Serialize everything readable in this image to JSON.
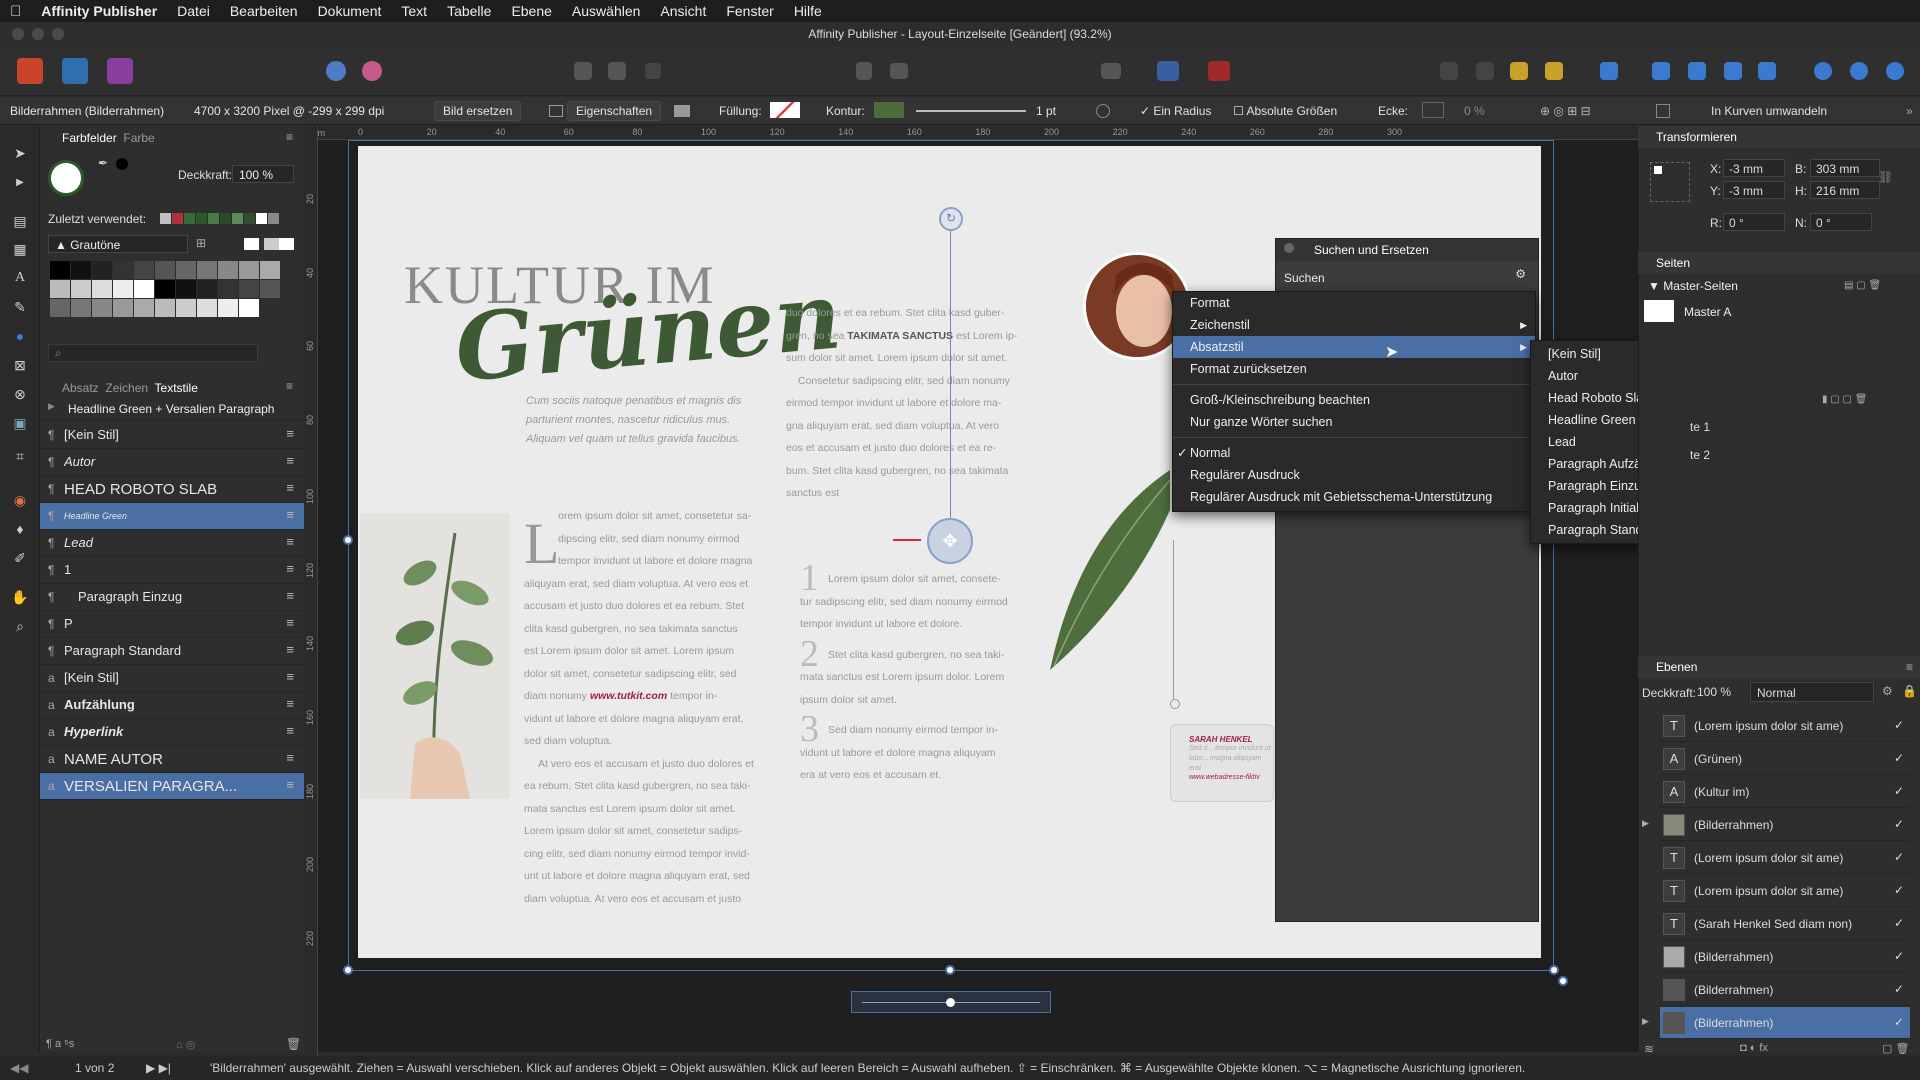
{
  "menubar": {
    "app": "Affinity Publisher",
    "items": [
      "Datei",
      "Bearbeiten",
      "Dokument",
      "Text",
      "Tabelle",
      "Ebene",
      "Auswählen",
      "Ansicht",
      "Fenster",
      "Hilfe"
    ]
  },
  "window": {
    "title": "Affinity Publisher - Layout-Einzelseite [Geändert] (93.2%)"
  },
  "context": {
    "selection": "Bilderrahmen (Bilderrahmen)",
    "size_info": "4700 x 3200 Pixel @ -299 x 299 dpi",
    "replace_btn": "Bild ersetzen",
    "properties_btn": "Eigenschaften",
    "fill_label": "Füllung:",
    "stroke_label": "Kontur:",
    "stroke_width": "1 pt",
    "radius_label": "Ein Radius",
    "absolute_label": "Absolute Größen",
    "corner_label": "Ecke:",
    "corner_value": "0 %",
    "convert_btn": "In Kurven umwandeln",
    "stroke_color": "#4f6b3b"
  },
  "swatches": {
    "tab_swatches": "Farbfelder",
    "tab_color": "Farbe",
    "opacity_label": "Deckkraft:",
    "opacity_value": "100 %",
    "recent_label": "Zuletzt verwendet:",
    "palette": "Grautöne",
    "recent": [
      "#c0c0c0",
      "#b03040",
      "#3a6a3a",
      "#2a5a2a",
      "#4a7a4a",
      "#2a4a2a",
      "#5a8a5a",
      "#2f4f2f",
      "#ffffff",
      "#888888"
    ],
    "greys": [
      "#000000",
      "#111111",
      "#222222",
      "#333333",
      "#444444",
      "#555555",
      "#666666",
      "#777777",
      "#888888",
      "#999999",
      "#aaaaaa",
      "#bbbbbb",
      "#cccccc",
      "#dddddd",
      "#eeeeee",
      "#ffffff"
    ]
  },
  "styles": {
    "tabs": [
      "Absatz",
      "Zeichen",
      "Textstile"
    ],
    "group": "Headline Green + Versalien Paragraph",
    "items": [
      {
        "label": "[Kein Stil]",
        "icon": "¶"
      },
      {
        "label": "Autor",
        "icon": "¶"
      },
      {
        "label": "HEAD ROBOTO SLAB",
        "icon": "¶"
      },
      {
        "label": "Headline Green",
        "icon": "¶"
      },
      {
        "label": "Lead",
        "icon": "¶"
      },
      {
        "label": "1",
        "icon": "¶"
      },
      {
        "label": "Paragraph Einzug",
        "icon": "¶"
      },
      {
        "label": "P",
        "icon": "¶"
      },
      {
        "label": "Paragraph Standard",
        "icon": "¶"
      },
      {
        "label": "[Kein Stil]",
        "icon": "a"
      },
      {
        "label": "Aufzählung",
        "icon": "a"
      },
      {
        "label": "Hyperlink",
        "icon": "a"
      },
      {
        "label": "NAME AUTOR",
        "icon": "a"
      },
      {
        "label": "VERSALIEN PARAGRA...",
        "icon": "a"
      }
    ]
  },
  "ruler": {
    "ticks": [
      "0",
      "20",
      "40",
      "60",
      "80",
      "100",
      "120",
      "140",
      "160",
      "180",
      "200",
      "220",
      "240",
      "260",
      "280",
      "300"
    ],
    "vticks": [
      "20",
      "40",
      "60",
      "80",
      "100",
      "120",
      "140",
      "160",
      "180",
      "200",
      "220"
    ],
    "unit": "mm"
  },
  "page": {
    "headline1": "KULTUR IM",
    "headline2": "Grünen",
    "intro": "Cum sociis natoque penatibus et magnis dis parturient montes, nascetur ridiculus mus. Aliquam vel quam ut tellus gravida faucibus.",
    "col2_top": [
      "duo dolores et ea rebum. Stet clita kasd guber-",
      "gren, no sea TAKIMATA SANCTUS est Lorem ip-",
      "sum dolor sit amet. Lorem ipsum dolor sit amet.",
      "Consetetur sadipscing elitr, sed diam nonumy",
      "eirmod tempor invidunt ut labore et dolore ma-",
      "gna aliquyam erat, sed diam voluptua. At vero",
      "eos et accusam et justo duo dolores et ea re-",
      "bum. Stet clita kasd gubergren, no sea takimata",
      "sanctus est"
    ],
    "col1": [
      "orem ipsum dolor sit amet, consetetur sa-",
      "dipscing elitr, sed diam nonumy eirmod",
      "tempor invidunt ut labore et dolore magna",
      "aliquyam erat, sed diam voluptua. At vero eos et",
      "accusam et justo duo dolores et ea rebum. Stet",
      "clita kasd gubergren, no sea takimata sanctus",
      "est Lorem ipsum dolor sit amet. Lorem ipsum",
      "dolor sit amet, consetetur sadipscing elitr, sed",
      "diam nonumy www.tutkit.com tempor in-",
      "vidunt ut labore et dolore magna aliquyam erat,",
      "sed diam voluptua.",
      "At vero eos et accusam et justo duo dolores et",
      "ea rebum. Stet clita kasd gubergren, no sea taki-",
      "mata sanctus est Lorem ipsum dolor sit amet.",
      "Lorem ipsum dolor sit amet, consetetur sadips-",
      "cing elitr, sed diam nonumy eirmod tempor invid-",
      "unt ut labore et dolore magna aliquyam erat, sed",
      "diam voluptua. At vero eos et accusam et justo"
    ],
    "list": [
      {
        "n": "1",
        "lines": [
          "Lorem ipsum dolor sit amet, consete-",
          "tur sadipscing elitr, sed diam nonumy eirmod",
          "tempor invidunt ut labore et dolore."
        ]
      },
      {
        "n": "2",
        "lines": [
          "Stet clita kasd gubergren, no sea taki-",
          "mata sanctus est Lorem ipsum dolor. Lorem",
          "ipsum dolor sit amet."
        ]
      },
      {
        "n": "3",
        "lines": [
          "Sed diam nonumy eirmod tempor in-",
          "vidunt ut labore et dolore magna aliquyam",
          "era at vero eos et accusam et."
        ]
      }
    ],
    "quote_name": "SARAH HENKEL",
    "quote_text": "Sed d... tempor invidunt ut labo... magna aliquyam erat",
    "quote_link": "www.webadresse-fiktiv"
  },
  "find": {
    "title": "Suchen und Ersetzen",
    "search": "Suchen"
  },
  "menu1": {
    "items": [
      {
        "label": "Format",
        "sub": false
      },
      {
        "label": "Zeichenstil",
        "sub": true
      },
      {
        "label": "Absatzstil",
        "sub": true,
        "hl": true
      },
      {
        "label": "Format zurücksetzen",
        "sub": false
      },
      {
        "sep": true
      },
      {
        "label": "Groß-/Kleinschreibung beachten"
      },
      {
        "label": "Nur ganze Wörter suchen"
      },
      {
        "sep": true
      },
      {
        "label": "Normal",
        "check": true
      },
      {
        "label": "Regulärer Ausdruck"
      },
      {
        "label": "Regulärer Ausdruck mit Gebietsschema-Unterstützung"
      }
    ]
  },
  "menu2": {
    "items": [
      "[Kein Stil]",
      "Autor",
      "Head Roboto Slab",
      "Headline Green",
      "Lead",
      "Paragraph Aufzählung",
      "Paragraph Einzug",
      "Paragraph Initial",
      "Paragraph Standard"
    ]
  },
  "transform": {
    "title": "Transformieren",
    "x_label": "X:",
    "x": "-3 mm",
    "y_label": "Y:",
    "y": "-3 mm",
    "b_label": "B:",
    "b": "303 mm",
    "h_label": "H:",
    "h": "216 mm",
    "r_label": "R:",
    "r": "0 °",
    "n_label": "N:",
    "n": "0 °"
  },
  "pages": {
    "title": "Seiten",
    "master_title": "Master-Seiten",
    "master": "Master A",
    "page1": "te 1",
    "page2": "te 2"
  },
  "layers": {
    "title": "Ebenen",
    "opacity_label": "Deckkraft:",
    "opacity": "100 %",
    "blend": "Normal",
    "items": [
      {
        "label": "(Lorem ipsum dolor sit ame)",
        "icon": "T"
      },
      {
        "label": "(Grünen)",
        "icon": "A"
      },
      {
        "label": "(Kultur im)",
        "icon": "A"
      },
      {
        "label": "(Bilderrahmen)",
        "icon": "img"
      },
      {
        "label": "(Lorem ipsum dolor sit ame)",
        "icon": "T"
      },
      {
        "label": "(Lorem ipsum dolor sit ame)",
        "icon": "T"
      },
      {
        "label": "(Sarah Henkel Sed diam non)",
        "icon": "T"
      },
      {
        "label": "(Bilderrahmen)",
        "icon": "img"
      },
      {
        "label": "(Bilderrahmen)",
        "icon": "img"
      },
      {
        "label": "(Bilderrahmen)",
        "icon": "img"
      }
    ]
  },
  "status": {
    "page": "1 von 2",
    "hint": "'Bilderrahmen' ausgewählt. Ziehen = Auswahl verschieben. Klick auf anderes Objekt = Objekt auswählen. Klick auf leeren Bereich = Auswahl aufheben. ⇧ = Einschränken. ⌘ = Ausgewählte Objekte klonen. ⌥ = Magnetische Ausrichtung ignorieren."
  },
  "colors": {
    "accent": "#4a6fa5",
    "headline_green": "#3e5a34",
    "link_red": "#a02040"
  }
}
